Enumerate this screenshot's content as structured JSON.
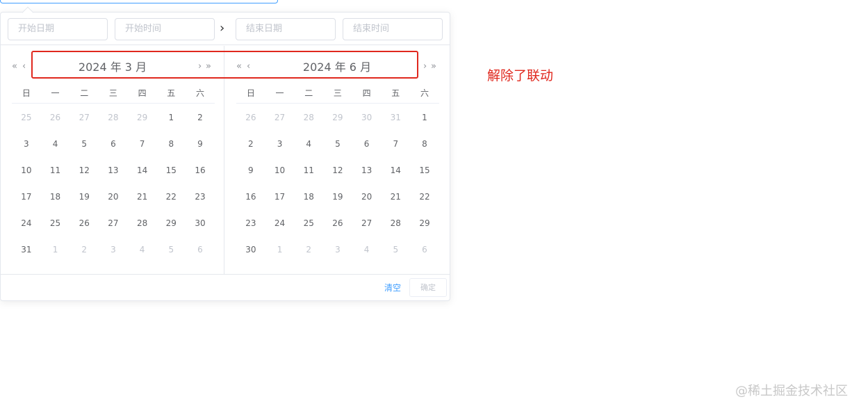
{
  "inputs": {
    "start_date_placeholder": "开始日期",
    "start_time_placeholder": "开始时间",
    "end_date_placeholder": "结束日期",
    "end_time_placeholder": "结束时间",
    "separator": "›"
  },
  "nav": {
    "prev_year": "«",
    "prev_month": "‹",
    "next_month": "›",
    "next_year": "»"
  },
  "left_panel": {
    "title": "2024 年 3 月",
    "weekdays": [
      "日",
      "一",
      "二",
      "三",
      "四",
      "五",
      "六"
    ],
    "days": [
      {
        "n": "25",
        "cur": false
      },
      {
        "n": "26",
        "cur": false
      },
      {
        "n": "27",
        "cur": false
      },
      {
        "n": "28",
        "cur": false
      },
      {
        "n": "29",
        "cur": false
      },
      {
        "n": "1",
        "cur": true
      },
      {
        "n": "2",
        "cur": true
      },
      {
        "n": "3",
        "cur": true
      },
      {
        "n": "4",
        "cur": true
      },
      {
        "n": "5",
        "cur": true
      },
      {
        "n": "6",
        "cur": true
      },
      {
        "n": "7",
        "cur": true
      },
      {
        "n": "8",
        "cur": true
      },
      {
        "n": "9",
        "cur": true
      },
      {
        "n": "10",
        "cur": true
      },
      {
        "n": "11",
        "cur": true
      },
      {
        "n": "12",
        "cur": true
      },
      {
        "n": "13",
        "cur": true
      },
      {
        "n": "14",
        "cur": true
      },
      {
        "n": "15",
        "cur": true
      },
      {
        "n": "16",
        "cur": true
      },
      {
        "n": "17",
        "cur": true
      },
      {
        "n": "18",
        "cur": true
      },
      {
        "n": "19",
        "cur": true
      },
      {
        "n": "20",
        "cur": true
      },
      {
        "n": "21",
        "cur": true
      },
      {
        "n": "22",
        "cur": true
      },
      {
        "n": "23",
        "cur": true
      },
      {
        "n": "24",
        "cur": true
      },
      {
        "n": "25",
        "cur": true
      },
      {
        "n": "26",
        "cur": true
      },
      {
        "n": "27",
        "cur": true
      },
      {
        "n": "28",
        "cur": true
      },
      {
        "n": "29",
        "cur": true
      },
      {
        "n": "30",
        "cur": true
      },
      {
        "n": "31",
        "cur": true
      },
      {
        "n": "1",
        "cur": false
      },
      {
        "n": "2",
        "cur": false
      },
      {
        "n": "3",
        "cur": false
      },
      {
        "n": "4",
        "cur": false
      },
      {
        "n": "5",
        "cur": false
      },
      {
        "n": "6",
        "cur": false
      }
    ]
  },
  "right_panel": {
    "title": "2024 年 6 月",
    "weekdays": [
      "日",
      "一",
      "二",
      "三",
      "四",
      "五",
      "六"
    ],
    "days": [
      {
        "n": "26",
        "cur": false
      },
      {
        "n": "27",
        "cur": false
      },
      {
        "n": "28",
        "cur": false
      },
      {
        "n": "29",
        "cur": false
      },
      {
        "n": "30",
        "cur": false
      },
      {
        "n": "31",
        "cur": false
      },
      {
        "n": "1",
        "cur": true
      },
      {
        "n": "2",
        "cur": true
      },
      {
        "n": "3",
        "cur": true
      },
      {
        "n": "4",
        "cur": true
      },
      {
        "n": "5",
        "cur": true
      },
      {
        "n": "6",
        "cur": true
      },
      {
        "n": "7",
        "cur": true
      },
      {
        "n": "8",
        "cur": true
      },
      {
        "n": "9",
        "cur": true
      },
      {
        "n": "10",
        "cur": true
      },
      {
        "n": "11",
        "cur": true
      },
      {
        "n": "12",
        "cur": true
      },
      {
        "n": "13",
        "cur": true
      },
      {
        "n": "14",
        "cur": true
      },
      {
        "n": "15",
        "cur": true
      },
      {
        "n": "16",
        "cur": true
      },
      {
        "n": "17",
        "cur": true
      },
      {
        "n": "18",
        "cur": true
      },
      {
        "n": "19",
        "cur": true
      },
      {
        "n": "20",
        "cur": true
      },
      {
        "n": "21",
        "cur": true
      },
      {
        "n": "22",
        "cur": true
      },
      {
        "n": "23",
        "cur": true
      },
      {
        "n": "24",
        "cur": true
      },
      {
        "n": "25",
        "cur": true
      },
      {
        "n": "26",
        "cur": true
      },
      {
        "n": "27",
        "cur": true
      },
      {
        "n": "28",
        "cur": true
      },
      {
        "n": "29",
        "cur": true
      },
      {
        "n": "30",
        "cur": true
      },
      {
        "n": "1",
        "cur": false
      },
      {
        "n": "2",
        "cur": false
      },
      {
        "n": "3",
        "cur": false
      },
      {
        "n": "4",
        "cur": false
      },
      {
        "n": "5",
        "cur": false
      },
      {
        "n": "6",
        "cur": false
      }
    ]
  },
  "footer": {
    "clear_label": "清空",
    "ok_label": "确定"
  },
  "annotation": {
    "text": "解除了联动"
  },
  "watermark": "@稀土掘金技术社区",
  "colors": {
    "accent": "#409eff",
    "highlight": "#e0281e",
    "muted": "#c0c4cc",
    "text": "#606266"
  },
  "icons": {
    "separator": "chevron-right-icon",
    "prev_year": "double-chevron-left-icon",
    "prev_month": "chevron-left-icon",
    "next_month": "chevron-right-icon",
    "next_year": "double-chevron-right-icon"
  }
}
